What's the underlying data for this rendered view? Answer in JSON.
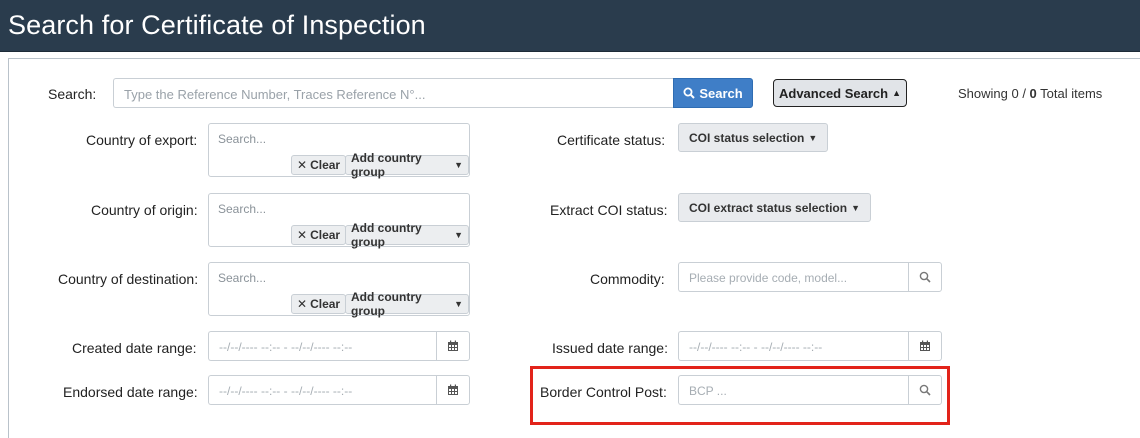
{
  "header": {
    "title": "Search for Certificate of Inspection"
  },
  "search": {
    "label": "Search:",
    "placeholder": "Type the Reference Number, Traces Reference N°...",
    "button_label": "Search",
    "advanced_label": "Advanced Search",
    "showing_prefix": "Showing 0 / ",
    "showing_count": "0",
    "showing_suffix": " Total items"
  },
  "country_fields": [
    {
      "label": "Country of export:",
      "placeholder": "Search...",
      "clear": "Clear",
      "group": "Add country group"
    },
    {
      "label": "Country of origin:",
      "placeholder": "Search...",
      "clear": "Clear",
      "group": "Add country group"
    },
    {
      "label": "Country of destination:",
      "placeholder": "Search...",
      "clear": "Clear",
      "group": "Add country group"
    }
  ],
  "date_fields": {
    "created": {
      "label": "Created date range:",
      "placeholder": "--/--/---- --:-- - --/--/---- --:--"
    },
    "endorsed": {
      "label": "Endorsed date range:",
      "placeholder": "--/--/---- --:-- - --/--/---- --:--"
    },
    "issued": {
      "label": "Issued date range:",
      "placeholder": "--/--/---- --:-- - --/--/---- --:--"
    }
  },
  "right_fields": {
    "certificate_status": {
      "label": "Certificate status:",
      "button": "COI status selection"
    },
    "extract_status": {
      "label": "Extract COI status:",
      "button": "COI extract status selection"
    },
    "commodity": {
      "label": "Commodity:",
      "placeholder": "Please provide code, model..."
    },
    "bcp": {
      "label": "Border Control Post:",
      "placeholder": "BCP ..."
    }
  },
  "icons": {
    "search": "search-icon",
    "calendar": "calendar-icon",
    "close": "close-icon",
    "caret_up": "caret-up-icon",
    "caret_down": "caret-down-icon"
  },
  "colors": {
    "header_bg": "#2a3c4d",
    "primary": "#3f7ec7",
    "highlight": "#e2231a"
  }
}
